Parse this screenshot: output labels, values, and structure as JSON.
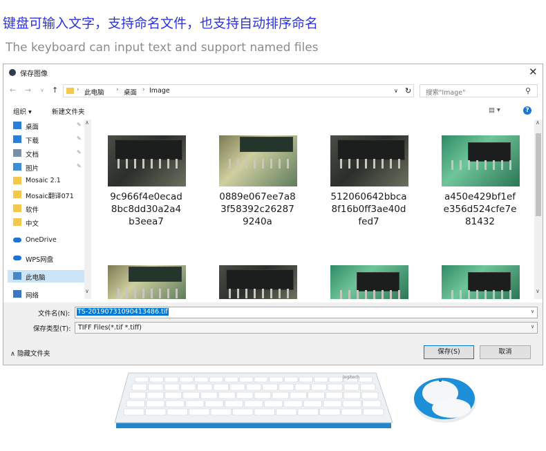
{
  "headline_cn": "键盘可输入文字，支持命名文件，也支持自动排序命名",
  "headline_en": "The keyboard can input text and support named files",
  "dialog": {
    "title": "保存图像",
    "close_glyph": "✕",
    "nav": {
      "back": "←",
      "forward": "→",
      "dropdown": "∨",
      "up": "↑"
    },
    "breadcrumb": [
      "此电脑",
      "桌面",
      "Image"
    ],
    "breadcrumb_sep": "›",
    "addr_dropdown": "∨",
    "refresh_glyph": "↻",
    "search_placeholder": "搜索\"Image\"",
    "search_glyph": "⚲",
    "toolbar": {
      "organize": "组织 ▾",
      "new_folder": "新建文件夹",
      "view_glyph": "▤ ▾",
      "help": "?"
    },
    "sidebar": [
      {
        "label": "桌面",
        "icon": "desktop-icon",
        "pinned": true
      },
      {
        "label": "下载",
        "icon": "download-icon",
        "pinned": true
      },
      {
        "label": "文档",
        "icon": "document-icon",
        "pinned": true
      },
      {
        "label": "图片",
        "icon": "picture-icon",
        "pinned": true
      },
      {
        "label": "Mosaic 2.1",
        "icon": "folder-icon",
        "pinned": false
      },
      {
        "label": "Mosaic翻译071",
        "icon": "folder-icon",
        "pinned": false
      },
      {
        "label": "软件",
        "icon": "folder-icon",
        "pinned": false
      },
      {
        "label": "中文",
        "icon": "folder-icon",
        "pinned": false
      },
      {
        "label": "OneDrive",
        "icon": "cloud-icon",
        "pinned": false
      },
      {
        "label": "WPS网盘",
        "icon": "cloud-icon",
        "pinned": false
      },
      {
        "label": "此电脑",
        "icon": "computer-icon",
        "pinned": false,
        "selected": true
      },
      {
        "label": "网络",
        "icon": "network-icon",
        "pinned": false
      }
    ],
    "pin_glyph": "📌",
    "files": [
      {
        "name": "9c966f4e0ecad8bc8dd30a2a4b3eea7",
        "lines": [
          "9c966f4e0ecad",
          "8bc8dd30a2a4",
          "b3eea7"
        ]
      },
      {
        "name": "0889e067ee7a83f58392c262879240a",
        "lines": [
          "0889e067ee7a8",
          "3f58392c26287",
          "9240a"
        ]
      },
      {
        "name": "512060642bbca8f16b0ff3ae40dfed7",
        "lines": [
          "512060642bbca",
          "8f16b0ff3ae40d",
          "fed7"
        ]
      },
      {
        "name": "a450e429bf1efe356d524cfe7e81432",
        "lines": [
          "a450e429bf1ef",
          "e356d524cfe7e",
          "81432"
        ]
      }
    ],
    "filename_label": "文件名(N):",
    "filename_value": "TS-20190731090413486.tif",
    "filetype_label": "保存类型(T):",
    "filetype_value": "TIFF Files(*.tif *.tiff)",
    "hide_folders": "∧ 隐藏文件夹",
    "save_button": "保存(S)",
    "cancel_button": "取消"
  },
  "product": {
    "keyboard_brand": "logitech"
  },
  "colors": {
    "headline_cn": "#2d33e0",
    "headline_en": "#8c8c8c",
    "selection": "#0078d7",
    "mouse_accent": "#1c8fd8"
  }
}
